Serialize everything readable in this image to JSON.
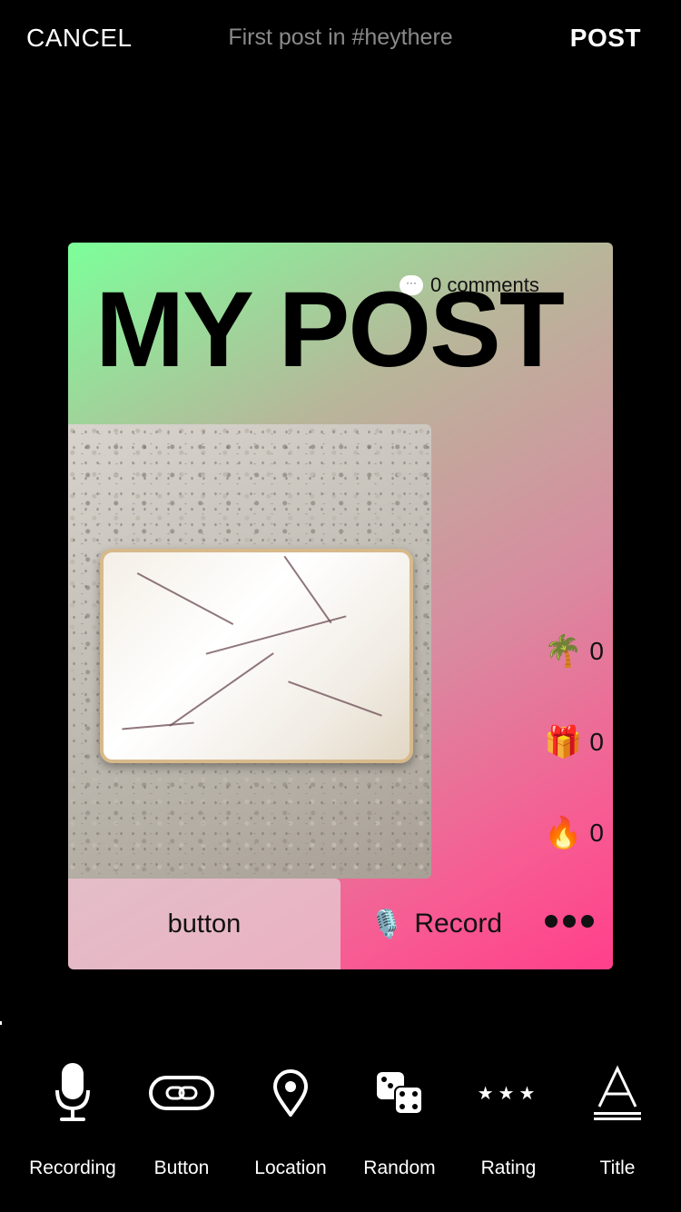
{
  "header": {
    "cancel_label": "CANCEL",
    "subtitle": "First post in #heythere",
    "post_label": "POST"
  },
  "card": {
    "title": "MY POST",
    "comments_label": "0 comments",
    "gradient_colors": [
      "#7cff9a",
      "#ff3f8a"
    ],
    "reactions": [
      {
        "icon": "palm-tree-icon",
        "emoji": "🌴",
        "count": "0"
      },
      {
        "icon": "gift-icon",
        "emoji": "🎁",
        "count": "0"
      },
      {
        "icon": "fire-icon",
        "emoji": "🔥",
        "count": "0"
      }
    ],
    "button_label": "button",
    "record_label": "Record",
    "record_icon": "microphone-icon",
    "more_icon": "more-dots-icon"
  },
  "toolbar": {
    "items": [
      {
        "label": "Recording",
        "icon": "microphone-icon"
      },
      {
        "label": "Button",
        "icon": "link-icon"
      },
      {
        "label": "Location",
        "icon": "location-pin-icon"
      },
      {
        "label": "Random",
        "icon": "dice-icon"
      },
      {
        "label": "Rating",
        "icon": "stars-icon"
      },
      {
        "label": "Title",
        "icon": "title-text-icon"
      }
    ]
  }
}
